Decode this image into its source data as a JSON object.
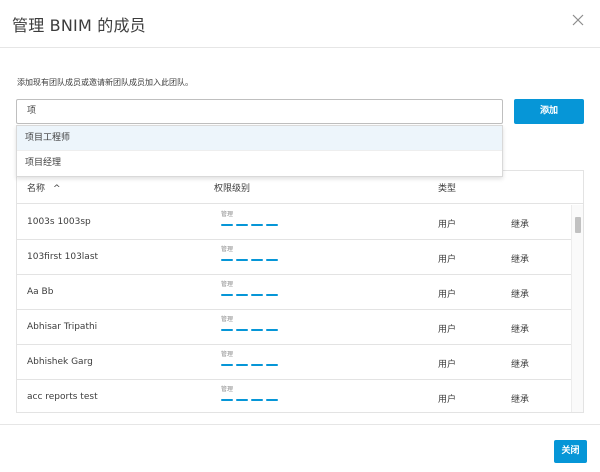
{
  "dialog": {
    "title": "管理 BNIM 的成员",
    "close_icon": "close-icon"
  },
  "instruction": "添加现有团队成员或邀请新团队成员加入此团队。",
  "search": {
    "value": "项"
  },
  "add_button": "添加",
  "dropdown": {
    "items": [
      "项目工程师",
      "项目经理"
    ]
  },
  "table": {
    "headers": {
      "name": "名称",
      "permission": "权限级别",
      "type": "类型"
    },
    "sort_icon": "chevron-up-icon",
    "rows": [
      {
        "name": "1003s 1003sp",
        "permission": "管理",
        "type": "用户",
        "inherit": "继承"
      },
      {
        "name": "103first 103last",
        "permission": "管理",
        "type": "用户",
        "inherit": "继承"
      },
      {
        "name": "Aa Bb",
        "permission": "管理",
        "type": "用户",
        "inherit": "继承"
      },
      {
        "name": "Abhisar Tripathi",
        "permission": "管理",
        "type": "用户",
        "inherit": "继承"
      },
      {
        "name": "Abhishek Garg",
        "permission": "管理",
        "type": "用户",
        "inherit": "继承"
      },
      {
        "name": "acc reports test",
        "permission": "管理",
        "type": "用户",
        "inherit": "继承"
      }
    ]
  },
  "footer": {
    "close_button": "关闭"
  },
  "colors": {
    "accent": "#0696d7",
    "border": "#e3e3e3",
    "text": "#3c3c3c"
  }
}
